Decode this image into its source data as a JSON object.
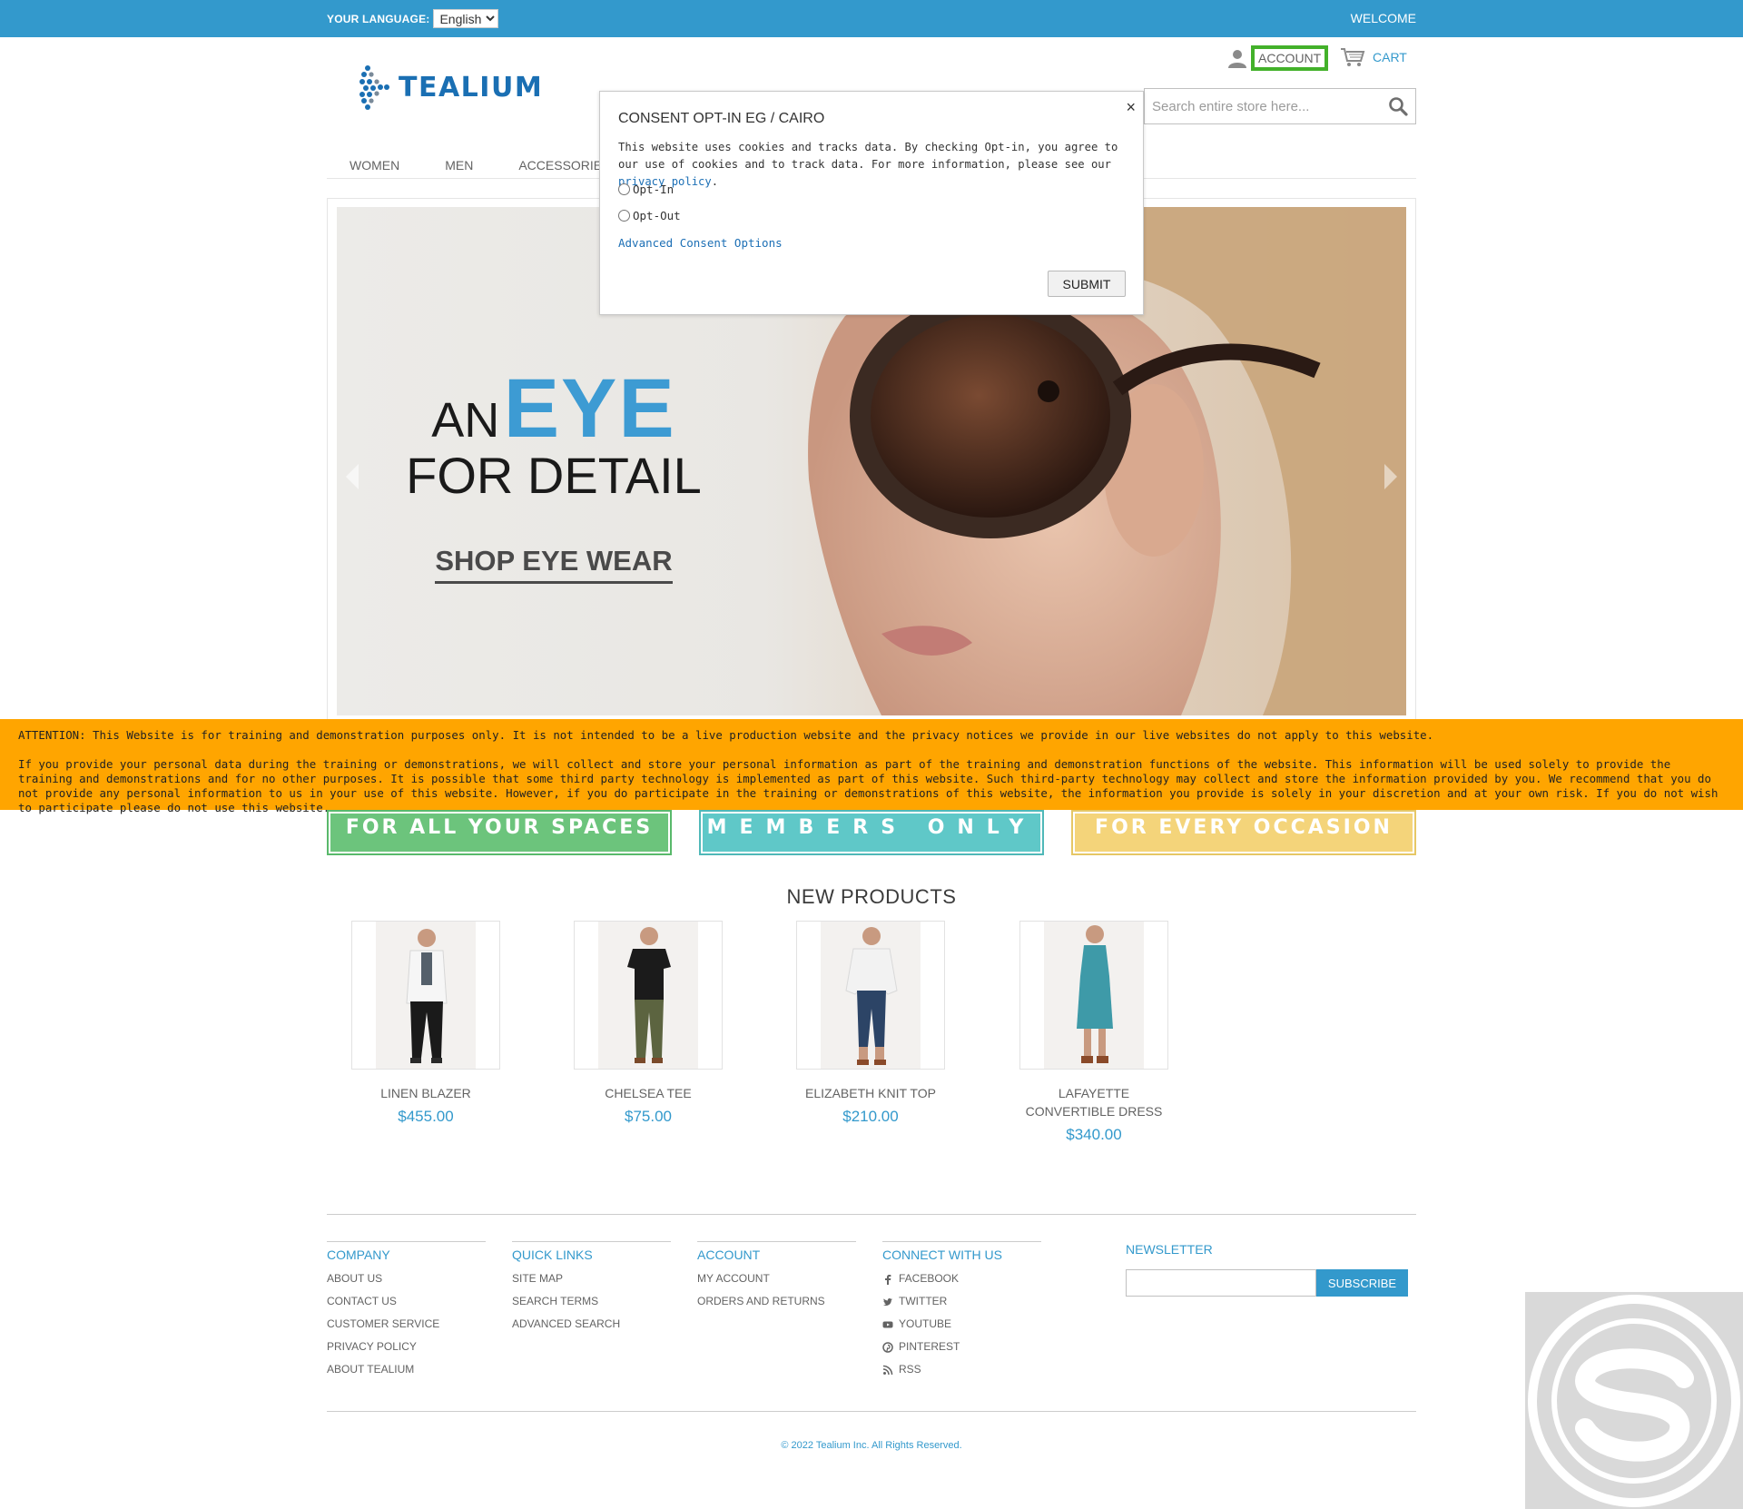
{
  "topbar": {
    "language_label": "YOUR LANGUAGE:",
    "language_value": "English",
    "welcome": "WELCOME"
  },
  "header": {
    "logo_text": "TEALIUM",
    "account_label": "ACCOUNT",
    "cart_label": "CART",
    "search_placeholder": "Search entire store here..."
  },
  "nav": {
    "items": [
      {
        "label": "WOMEN"
      },
      {
        "label": "MEN"
      },
      {
        "label": "ACCESSORIES"
      }
    ]
  },
  "hero": {
    "word_an": "AN",
    "word_eye": "EYE",
    "line2": "FOR DETAIL",
    "cta": "SHOP EYE WEAR"
  },
  "consent": {
    "title": "CONSENT OPT-IN EG / CAIRO",
    "body": "This website uses cookies and tracks data. By checking Opt-in, you agree to our use of cookies and to track data. For more information, please see our",
    "link": "privacy policy",
    "body_end": ".",
    "option_in": "Opt-In",
    "option_out": "Opt-Out",
    "advanced": "Advanced Consent Options",
    "submit": "SUBMIT",
    "close": "×"
  },
  "attention": {
    "line1": "ATTENTION: This Website is for training and demonstration purposes only. It is not intended to be a live production website and the privacy notices we provide in our live websites do not apply to this website.",
    "line2": "If you provide your personal data during the training or demonstrations, we will collect and store your personal information as part of the training and demonstration functions of the website. This information will be used solely to provide the training and demonstrations and for no other purposes. It is possible that some third party technology is implemented as part of this website. Such third-party technology may collect and store the information provided by you. We recommend that you do not provide any personal information to us in your use of this website. However, if you do participate in the training or demonstrations of this website, the information you provide is solely in your discretion and at your own risk. If you do not wish to participate please do not use this website."
  },
  "promos": [
    {
      "label": "FOR ALL YOUR SPACES"
    },
    {
      "label": "MEMBERS ONLY"
    },
    {
      "label": "FOR EVERY OCCASION"
    }
  ],
  "new_products": {
    "title": "NEW PRODUCTS",
    "items": [
      {
        "name": "LINEN BLAZER",
        "price": "$455.00"
      },
      {
        "name": "CHELSEA TEE",
        "price": "$75.00"
      },
      {
        "name": "ELIZABETH KNIT TOP",
        "price": "$210.00"
      },
      {
        "name": "LAFAYETTE CONVERTIBLE DRESS",
        "price": "$340.00"
      }
    ]
  },
  "footer": {
    "company": {
      "title": "COMPANY",
      "links": [
        "ABOUT US",
        "CONTACT US",
        "CUSTOMER SERVICE",
        "PRIVACY POLICY",
        "ABOUT TEALIUM"
      ]
    },
    "quick_links": {
      "title": "QUICK LINKS",
      "links": [
        "SITE MAP",
        "SEARCH TERMS",
        "ADVANCED SEARCH"
      ]
    },
    "account": {
      "title": "ACCOUNT",
      "links": [
        "MY ACCOUNT",
        "ORDERS AND RETURNS"
      ]
    },
    "connect": {
      "title": "CONNECT WITH US",
      "links": [
        "FACEBOOK",
        "TWITTER",
        "YOUTUBE",
        "PINTEREST",
        "RSS"
      ]
    },
    "newsletter": {
      "title": "NEWSLETTER",
      "button": "SUBSCRIBE"
    },
    "copyright": "© 2022 Tealium Inc. All Rights Reserved."
  },
  "colors": {
    "brand_blue": "#3399cc",
    "attention_orange": "#ffa500",
    "account_highlight": "#43b12a"
  }
}
